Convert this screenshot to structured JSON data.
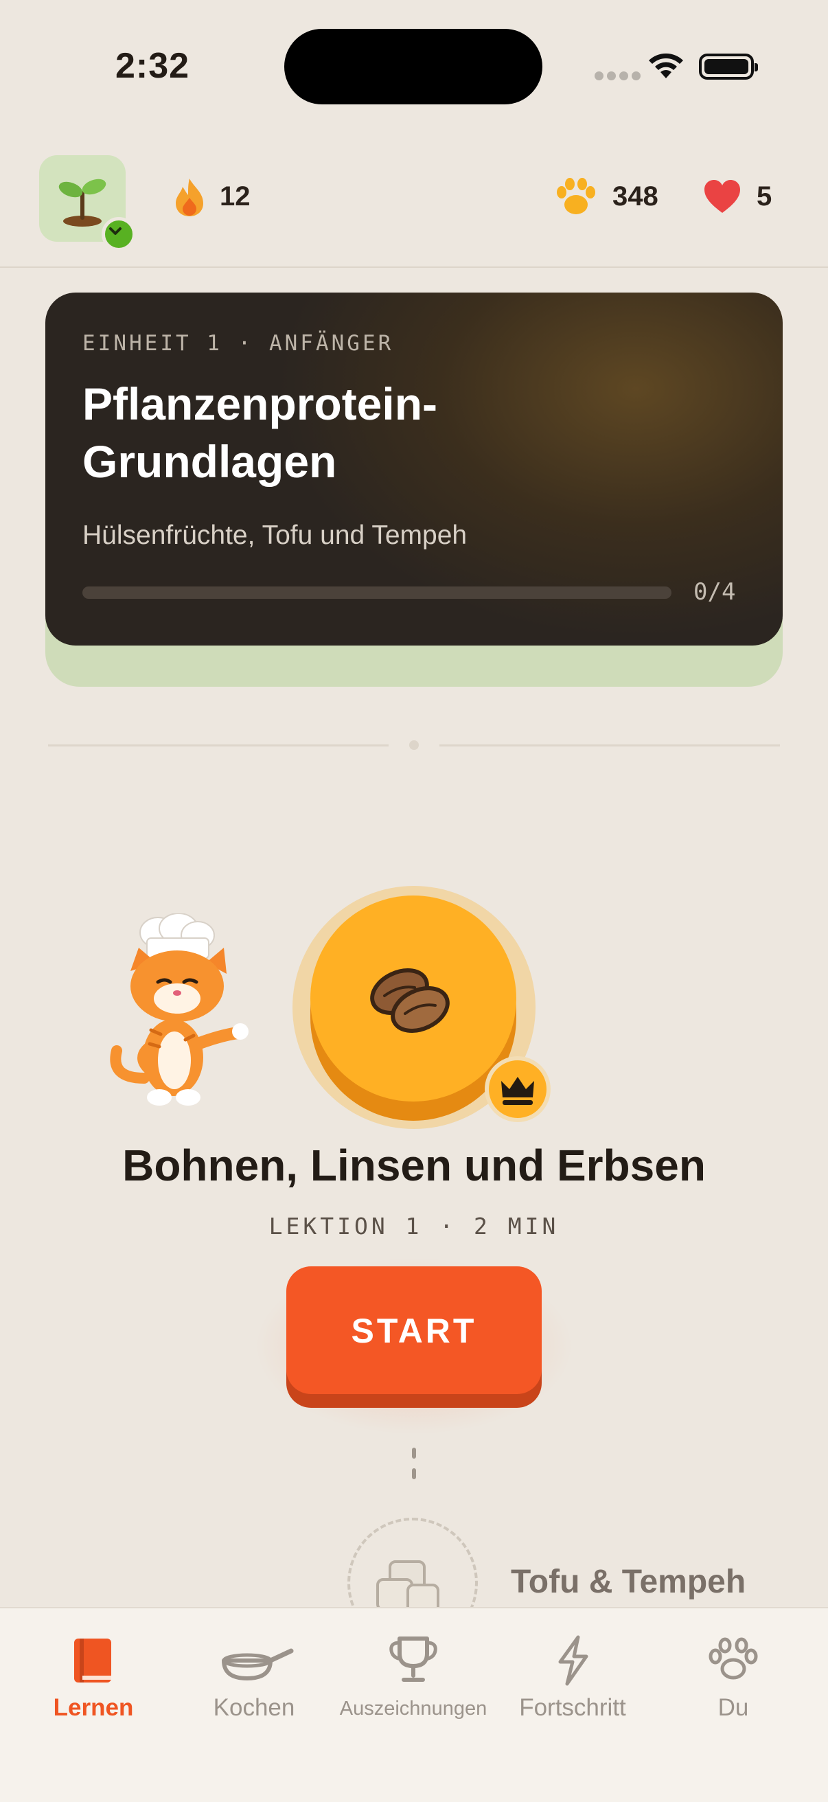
{
  "status_bar": {
    "time": "2:32"
  },
  "header": {
    "streak": "12",
    "paws": "348",
    "hearts": "5"
  },
  "unit": {
    "eyebrow": "EINHEIT 1 · ANFÄNGER",
    "title": "Pflanzenprotein-Grundlagen",
    "subtitle": "Hülsenfrüchte, Tofu und Tempeh",
    "progress_label": "0/4",
    "progress": 0
  },
  "lesson": {
    "title": "Bohnen, Linsen und Erbsen",
    "meta": "LEKTION 1 · 2 MIN",
    "start_label": "START"
  },
  "next_lesson": {
    "title": "Tofu & Tempeh"
  },
  "tabs": [
    {
      "label": "Lernen",
      "icon": "book-icon",
      "active": true
    },
    {
      "label": "Kochen",
      "icon": "pan-icon",
      "active": false
    },
    {
      "label": "Auszeichnungen",
      "icon": "trophy-icon",
      "active": false
    },
    {
      "label": "Fortschritt",
      "icon": "lightning-icon",
      "active": false
    },
    {
      "label": "Du",
      "icon": "paw-icon",
      "active": false
    }
  ],
  "colors": {
    "accent": "#f45725",
    "node": "#ffb024",
    "background": "#ede7df",
    "active_tab": "#ef5522"
  }
}
